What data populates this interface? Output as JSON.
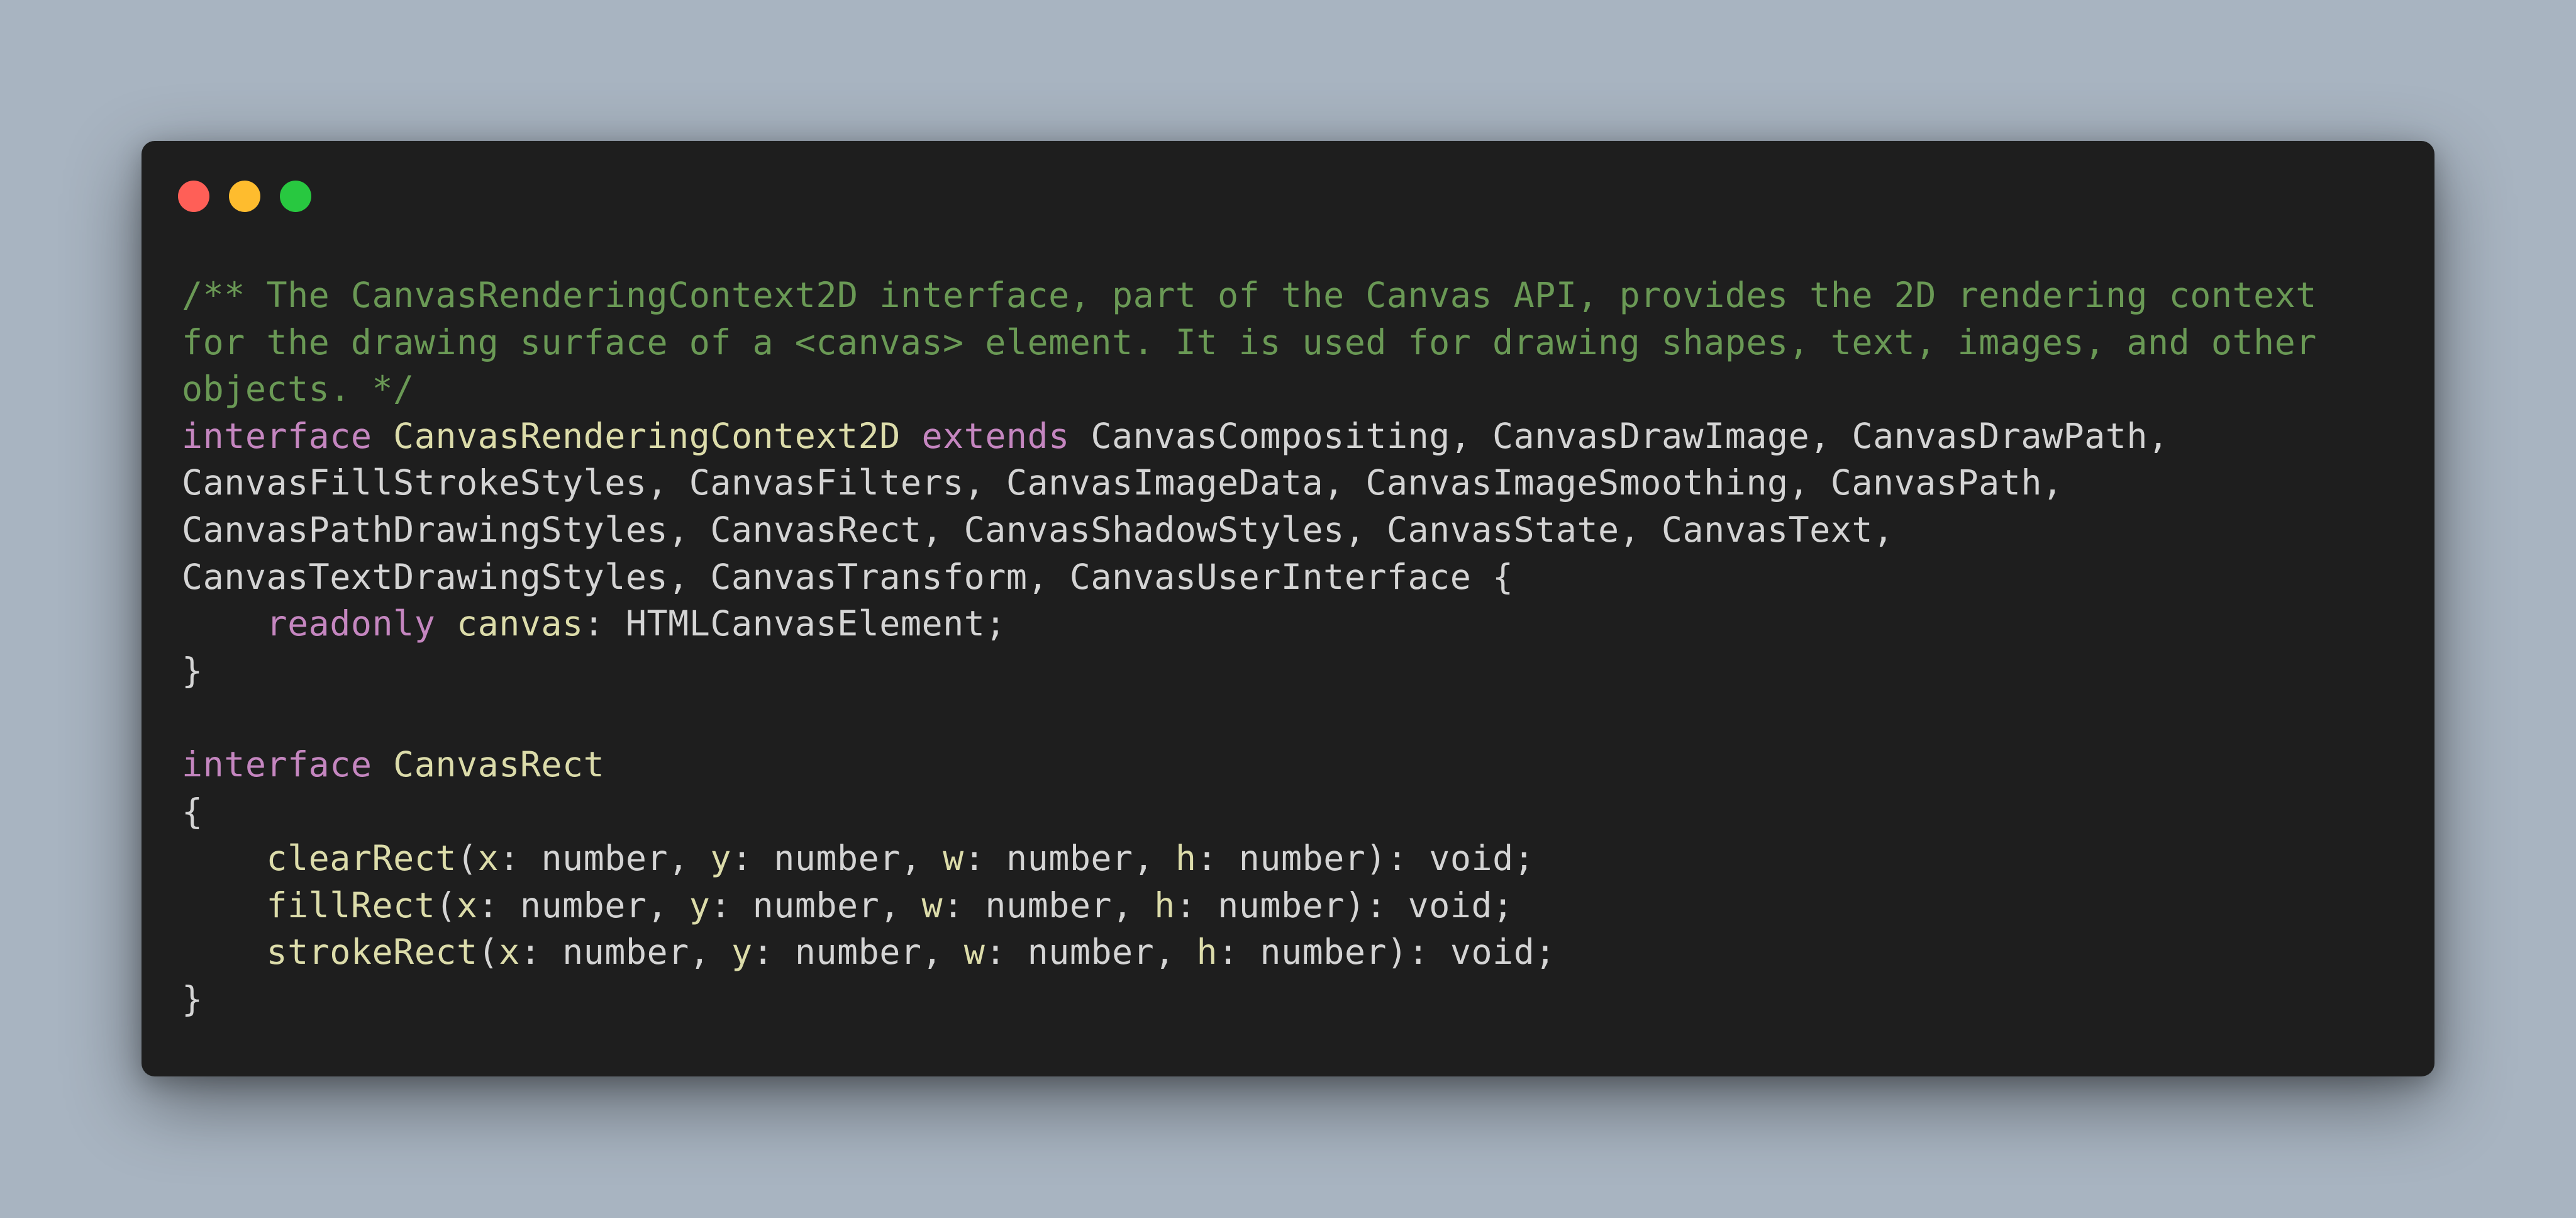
{
  "window": {
    "controls": [
      "close",
      "minimize",
      "maximize"
    ]
  },
  "code": {
    "lines": [
      [
        {
          "t": "/** The CanvasRenderingContext2D interface, part of the Canvas API, provides the 2D rendering context",
          "c": "comment"
        }
      ],
      [
        {
          "t": "for the drawing surface of a <canvas> element. It is used for drawing shapes, text, images, and other",
          "c": "comment"
        }
      ],
      [
        {
          "t": "objects. */",
          "c": "comment"
        }
      ],
      [
        {
          "t": "interface",
          "c": "kw"
        },
        {
          "t": " ",
          "c": "plain"
        },
        {
          "t": "CanvasRenderingContext2D",
          "c": "type"
        },
        {
          "t": " ",
          "c": "plain"
        },
        {
          "t": "extends",
          "c": "kw"
        },
        {
          "t": " CanvasCompositing, CanvasDrawImage, CanvasDrawPath,",
          "c": "plain"
        }
      ],
      [
        {
          "t": "CanvasFillStrokeStyles, CanvasFilters, CanvasImageData, CanvasImageSmoothing, CanvasPath,",
          "c": "plain"
        }
      ],
      [
        {
          "t": "CanvasPathDrawingStyles, CanvasRect, CanvasShadowStyles, CanvasState, CanvasText,",
          "c": "plain"
        }
      ],
      [
        {
          "t": "CanvasTextDrawingStyles, CanvasTransform, CanvasUserInterface {",
          "c": "plain"
        }
      ],
      [
        {
          "t": "    ",
          "c": "plain"
        },
        {
          "t": "readonly",
          "c": "kw"
        },
        {
          "t": " ",
          "c": "plain"
        },
        {
          "t": "canvas",
          "c": "prop"
        },
        {
          "t": ": HTMLCanvasElement;",
          "c": "plain"
        }
      ],
      [
        {
          "t": "}",
          "c": "plain"
        }
      ],
      [
        {
          "t": "",
          "c": "plain"
        }
      ],
      [
        {
          "t": "interface",
          "c": "kw"
        },
        {
          "t": " ",
          "c": "plain"
        },
        {
          "t": "CanvasRect",
          "c": "type"
        }
      ],
      [
        {
          "t": "{",
          "c": "plain"
        }
      ],
      [
        {
          "t": "    ",
          "c": "plain"
        },
        {
          "t": "clearRect",
          "c": "prop"
        },
        {
          "t": "(",
          "c": "plain"
        },
        {
          "t": "x",
          "c": "prop"
        },
        {
          "t": ": number, ",
          "c": "plain"
        },
        {
          "t": "y",
          "c": "prop"
        },
        {
          "t": ": number, ",
          "c": "plain"
        },
        {
          "t": "w",
          "c": "prop"
        },
        {
          "t": ": number, ",
          "c": "plain"
        },
        {
          "t": "h",
          "c": "prop"
        },
        {
          "t": ": number): void;",
          "c": "plain"
        }
      ],
      [
        {
          "t": "    ",
          "c": "plain"
        },
        {
          "t": "fillRect",
          "c": "prop"
        },
        {
          "t": "(",
          "c": "plain"
        },
        {
          "t": "x",
          "c": "prop"
        },
        {
          "t": ": number, ",
          "c": "plain"
        },
        {
          "t": "y",
          "c": "prop"
        },
        {
          "t": ": number, ",
          "c": "plain"
        },
        {
          "t": "w",
          "c": "prop"
        },
        {
          "t": ": number, ",
          "c": "plain"
        },
        {
          "t": "h",
          "c": "prop"
        },
        {
          "t": ": number): void;",
          "c": "plain"
        }
      ],
      [
        {
          "t": "    ",
          "c": "plain"
        },
        {
          "t": "strokeRect",
          "c": "prop"
        },
        {
          "t": "(",
          "c": "plain"
        },
        {
          "t": "x",
          "c": "prop"
        },
        {
          "t": ": number, ",
          "c": "plain"
        },
        {
          "t": "y",
          "c": "prop"
        },
        {
          "t": ": number, ",
          "c": "plain"
        },
        {
          "t": "w",
          "c": "prop"
        },
        {
          "t": ": number, ",
          "c": "plain"
        },
        {
          "t": "h",
          "c": "prop"
        },
        {
          "t": ": number): void;",
          "c": "plain"
        }
      ],
      [
        {
          "t": "}",
          "c": "plain"
        }
      ]
    ]
  },
  "colors": {
    "background": "#a8b4c1",
    "window": "#1e1e1e",
    "close": "#ff5f57",
    "minimize": "#febc2e",
    "maximize": "#28c840",
    "comment": "#6a9955",
    "keyword": "#c586c0",
    "type": "#dcdcaa",
    "plain": "#d4d4d4"
  }
}
